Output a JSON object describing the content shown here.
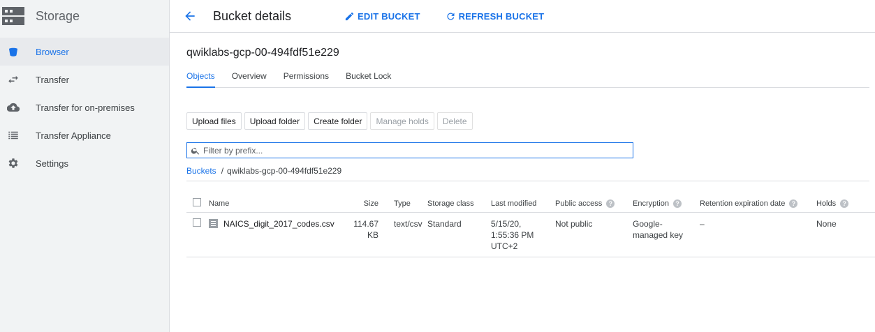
{
  "sidebar": {
    "title": "Storage",
    "items": [
      {
        "label": "Browser",
        "icon": "bucket-icon",
        "active": true
      },
      {
        "label": "Transfer",
        "icon": "transfer-arrows-icon"
      },
      {
        "label": "Transfer for on-premises",
        "icon": "cloud-upload-icon"
      },
      {
        "label": "Transfer Appliance",
        "icon": "list-icon"
      },
      {
        "label": "Settings",
        "icon": "gear-icon"
      }
    ]
  },
  "header": {
    "title": "Bucket details",
    "edit_label": "EDIT BUCKET",
    "refresh_label": "REFRESH BUCKET"
  },
  "bucket": {
    "name": "qwiklabs-gcp-00-494fdf51e229"
  },
  "tabs": [
    {
      "label": "Objects",
      "active": true
    },
    {
      "label": "Overview"
    },
    {
      "label": "Permissions"
    },
    {
      "label": "Bucket Lock"
    }
  ],
  "toolbar": {
    "upload_files": "Upload files",
    "upload_folder": "Upload folder",
    "create_folder": "Create folder",
    "manage_holds": "Manage holds",
    "delete": "Delete"
  },
  "filter": {
    "placeholder": "Filter by prefix...",
    "value": ""
  },
  "breadcrumb": {
    "root": "Buckets",
    "separator": "/",
    "current": "qwiklabs-gcp-00-494fdf51e229"
  },
  "table": {
    "headers": {
      "name": "Name",
      "size": "Size",
      "type": "Type",
      "storage_class": "Storage class",
      "last_modified": "Last modified",
      "public_access": "Public access",
      "encryption": "Encryption",
      "retention": "Retention expiration date",
      "holds": "Holds"
    },
    "rows": [
      {
        "name": "NAICS_digit_2017_codes.csv",
        "size_line1": "114.67",
        "size_line2": "KB",
        "type": "text/csv",
        "storage_class": "Standard",
        "modified_line1": "5/15/20,",
        "modified_line2": "1:55:36 PM",
        "modified_line3": "UTC+2",
        "public_access": "Not public",
        "encryption_line1": "Google-",
        "encryption_line2": "managed key",
        "retention": "–",
        "holds": "None"
      }
    ]
  },
  "colors": {
    "accent": "#1a73e8",
    "sidebar_bg": "#f1f3f4",
    "border": "#dadce0"
  }
}
